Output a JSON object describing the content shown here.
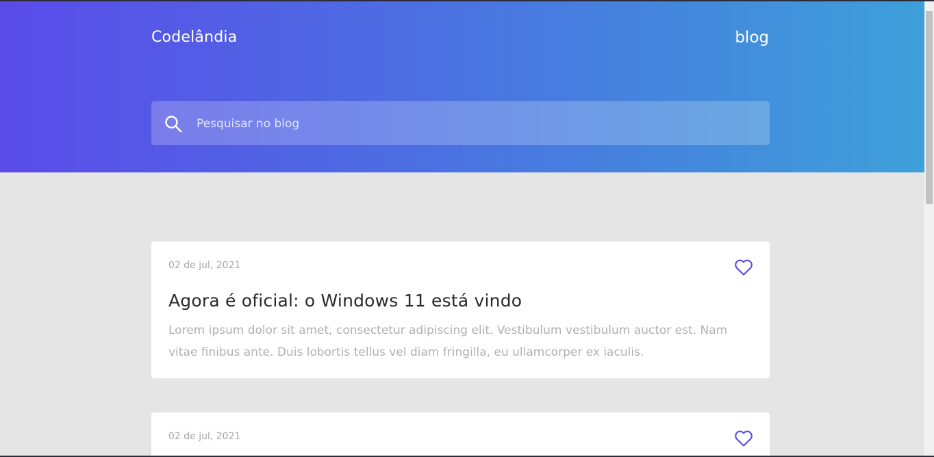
{
  "header": {
    "brand": "Codelândia",
    "nav_link": "blog"
  },
  "search": {
    "placeholder": "Pesquisar no blog",
    "icon": "search-icon"
  },
  "posts": [
    {
      "date": "02 de jul, 2021",
      "title": "Agora é oficial: o Windows 11 está vindo",
      "excerpt": "Lorem ipsum dolor sit amet, consectetur adipiscing elit. Vestibulum vestibulum auctor est. Nam vitae finibus ante. Duis lobortis tellus vel diam fringilla, eu ullamcorper ex iaculis.",
      "icon": "heart-icon"
    },
    {
      "date": "02 de jul, 2021",
      "icon": "heart-icon"
    }
  ],
  "colors": {
    "gradient_start": "#5a4be9",
    "gradient_end": "#3ea0d9",
    "accent": "#5b4de8",
    "page_bg": "#e5e5e5"
  }
}
